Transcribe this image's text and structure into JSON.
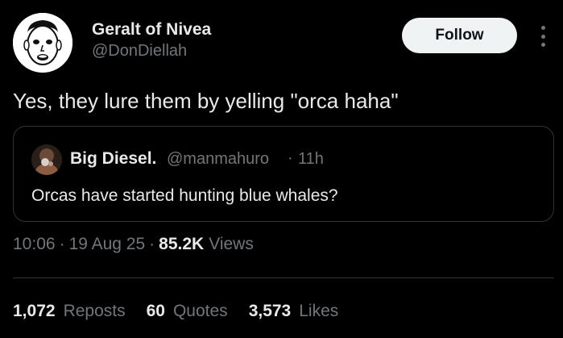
{
  "author": {
    "name": "Geralt of Nivea",
    "handle": "@DonDiellah",
    "avatar_icon": "cartoon-face-avatar"
  },
  "actions": {
    "follow_label": "Follow",
    "more_icon": "more-options-icon"
  },
  "tweet": {
    "text": "Yes, they lure them by yelling \"orca haha\""
  },
  "quote": {
    "author_name": "Big Diesel.",
    "author_handle": "@manmahuro",
    "separator": "·",
    "time": "11h",
    "text": "Orcas have started hunting blue whales?"
  },
  "meta": {
    "time": "10:06",
    "date": "19 Aug 25",
    "separator": "·",
    "views_count": "85.2K",
    "views_label": "Views"
  },
  "stats": [
    {
      "count": "1,072",
      "label": "Reposts"
    },
    {
      "count": "60",
      "label": "Quotes"
    },
    {
      "count": "3,573",
      "label": "Likes"
    }
  ],
  "colors": {
    "background": "#000000",
    "primary_text": "#e7e9ea",
    "secondary_text": "#71767b",
    "border": "#2f3336",
    "follow_bg": "#eff3f4"
  }
}
